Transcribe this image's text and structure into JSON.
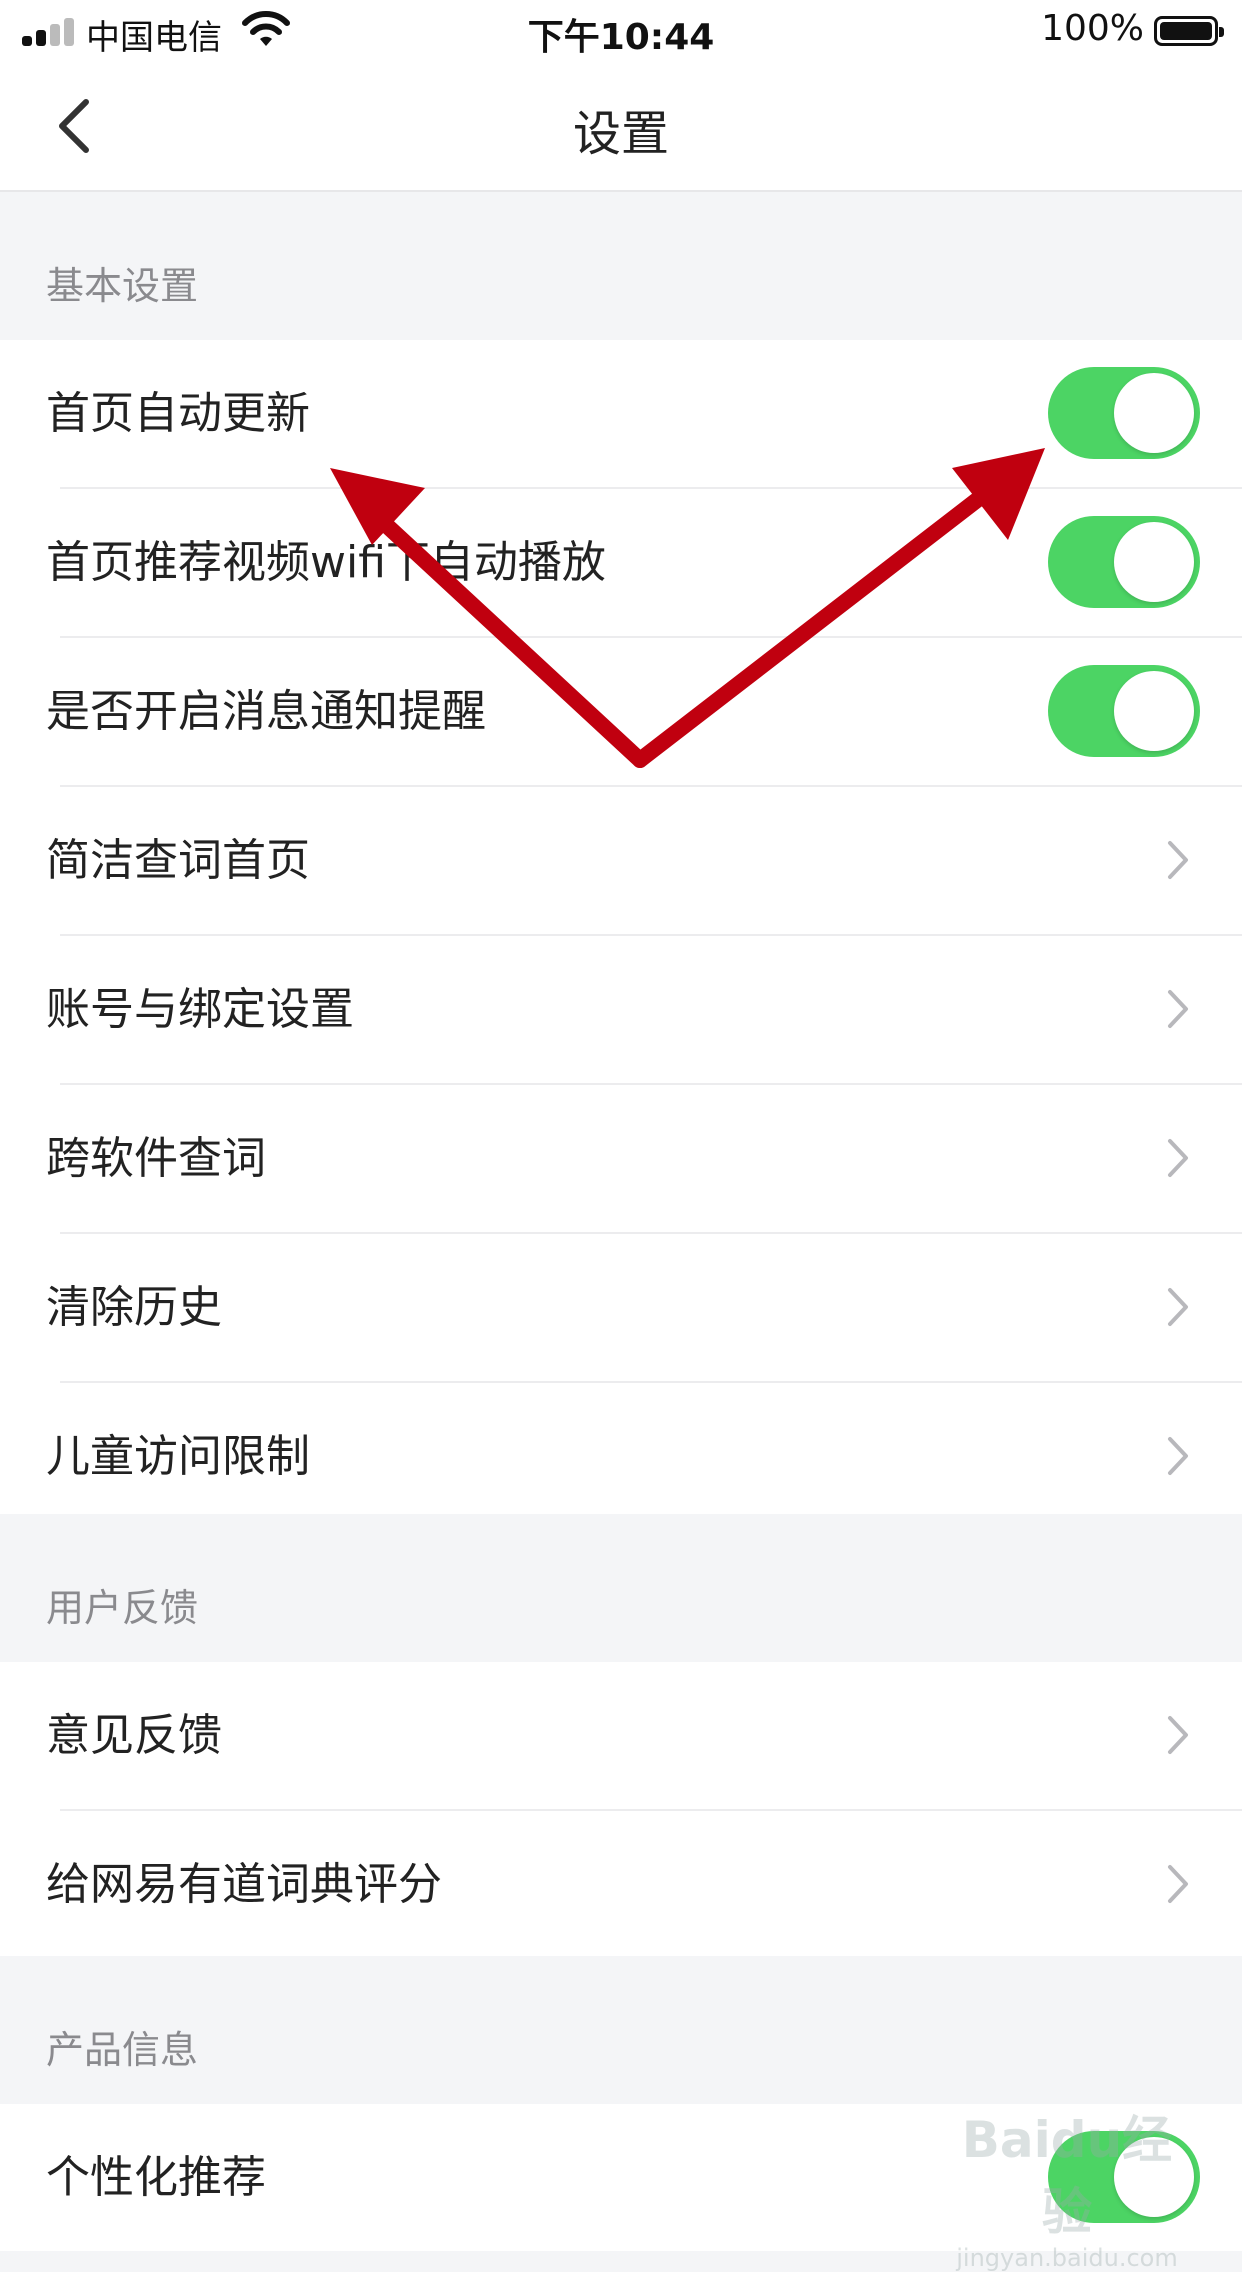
{
  "status_bar": {
    "carrier": "中国电信",
    "time": "下午10:44",
    "battery": "100%"
  },
  "nav": {
    "title": "设置"
  },
  "sections": {
    "basic": {
      "title": "基本设置",
      "items": [
        {
          "label": "首页自动更新",
          "type": "toggle",
          "on": true
        },
        {
          "label": "首页推荐视频wifi下自动播放",
          "type": "toggle",
          "on": true
        },
        {
          "label": "是否开启消息通知提醒",
          "type": "toggle",
          "on": true
        },
        {
          "label": "简洁查词首页",
          "type": "link"
        },
        {
          "label": "账号与绑定设置",
          "type": "link"
        },
        {
          "label": "跨软件查词",
          "type": "link"
        },
        {
          "label": "清除历史",
          "type": "link"
        },
        {
          "label": "儿童访问限制",
          "type": "link"
        }
      ]
    },
    "feedback": {
      "title": "用户反馈",
      "items": [
        {
          "label": "意见反馈",
          "type": "link"
        },
        {
          "label": "给网易有道词典评分",
          "type": "link"
        }
      ]
    },
    "product": {
      "title": "产品信息",
      "items": [
        {
          "label": "个性化推荐",
          "type": "toggle",
          "on": true
        }
      ]
    }
  },
  "watermark": {
    "logo": "Baidu经验",
    "url": "jingyan.baidu.com"
  },
  "colors": {
    "toggle_on": "#4cd464",
    "annotation_arrow": "#c0000f",
    "background": "#f4f5f7"
  }
}
